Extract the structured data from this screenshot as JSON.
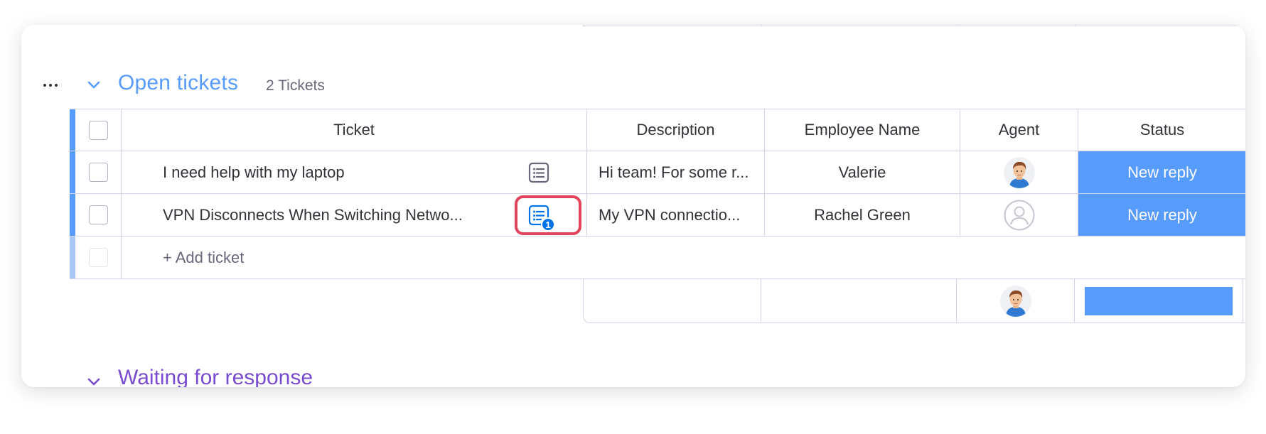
{
  "group": {
    "title": "Open tickets",
    "count": "2 Tickets",
    "color": "#579bfc"
  },
  "columns": {
    "ticket": "Ticket",
    "description": "Description",
    "employee": "Employee Name",
    "agent": "Agent",
    "status": "Status"
  },
  "rows": [
    {
      "ticket": "I need help with my laptop",
      "description": "Hi team! For some r...",
      "employee": "Valerie",
      "agent": "avatar-man",
      "status": "New reply",
      "updates": ""
    },
    {
      "ticket": "VPN Disconnects When Switching Netwo...",
      "description": "My VPN connectio...",
      "employee": "Rachel Green",
      "agent": "empty-person",
      "status": "New reply",
      "updates": "1"
    }
  ],
  "add_row": {
    "label": "+ Add ticket"
  },
  "next_group": {
    "title": "Waiting for response",
    "color": "#784bd1"
  },
  "colors": {
    "status_new_reply": "#579bfc",
    "highlight": "#e2445c",
    "badge": "#0073ea"
  }
}
